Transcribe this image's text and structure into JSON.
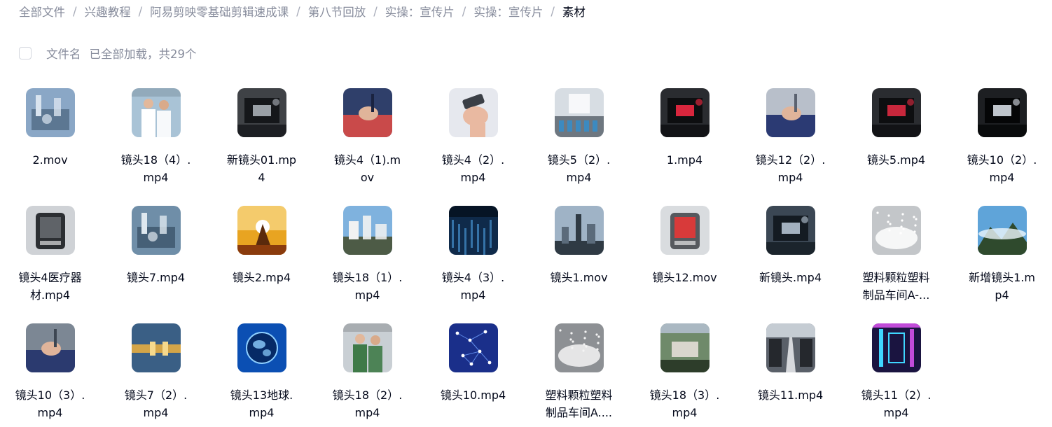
{
  "breadcrumb": [
    "全部文件",
    "兴趣教程",
    "阿易剪映零基础剪辑速成课",
    "第八节回放",
    "实操：宣传片",
    "实操：宣传片",
    "素材"
  ],
  "breadcrumb_separator": "/",
  "toolbar": {
    "sort_label": "文件名",
    "status": "已全部加载，共29个"
  },
  "files": [
    {
      "line1": "2.mov",
      "line2": "",
      "thumb": {
        "bg": "#8aa7c6",
        "accent": "#d9e4ef",
        "dark": "#3e5670",
        "kind": "lab"
      }
    },
    {
      "line1": "镜头18（4）.",
      "line2": "mp4",
      "thumb": {
        "bg": "#a9c3d6",
        "accent": "#ffffff",
        "dark": "#5d6f7f",
        "kind": "people"
      }
    },
    {
      "line1": "新镜头01.mp",
      "line2": "4",
      "thumb": {
        "bg": "#3f4246",
        "accent": "#9aa0a6",
        "dark": "#15171a",
        "kind": "machine"
      }
    },
    {
      "line1": "镜头4（1).m",
      "line2": "ov",
      "thumb": {
        "bg": "#2f3f6a",
        "accent": "#c94a4a",
        "dark": "#1a2340",
        "kind": "hand"
      }
    },
    {
      "line1": "镜头4（2）.",
      "line2": "mp4",
      "thumb": {
        "bg": "#e6e8ee",
        "accent": "#e9b9a1",
        "dark": "#3b3f46",
        "kind": "phone"
      }
    },
    {
      "line1": "镜头5（2）.",
      "line2": "mp4",
      "thumb": {
        "bg": "#d7dde3",
        "accent": "#2f8fd0",
        "dark": "#6e7780",
        "kind": "factory"
      }
    },
    {
      "line1": "1.mp4",
      "line2": "",
      "thumb": {
        "bg": "#2a2c30",
        "accent": "#d9263d",
        "dark": "#0d0e10",
        "kind": "machine"
      }
    },
    {
      "line1": "镜头12（2）.",
      "line2": "mp4",
      "thumb": {
        "bg": "#b8bfca",
        "accent": "#2b3a73",
        "dark": "#5b6270",
        "kind": "hand"
      }
    },
    {
      "line1": "镜头5.mp4",
      "line2": "",
      "thumb": {
        "bg": "#2a2c30",
        "accent": "#c8273c",
        "dark": "#0d0e10",
        "kind": "machine"
      }
    },
    {
      "line1": "镜头10（2）.",
      "line2": "mp4",
      "thumb": {
        "bg": "#1d1f22",
        "accent": "#bfc5cc",
        "dark": "#050607",
        "kind": "machine"
      }
    },
    {
      "line1": "镜头4医疗器",
      "line2": "材.mp4",
      "thumb": {
        "bg": "#cfd2d6",
        "accent": "#5f6368",
        "dark": "#2c2f33",
        "kind": "device"
      }
    },
    {
      "line1": "镜头7.mp4",
      "line2": "",
      "thumb": {
        "bg": "#6f8ea8",
        "accent": "#dfe8ef",
        "dark": "#2b4156",
        "kind": "lab"
      }
    },
    {
      "line1": "镜头2.mp4",
      "line2": "",
      "thumb": {
        "bg": "#e8a421",
        "accent": "#fff1b8",
        "dark": "#5a2a0c",
        "kind": "sunset"
      }
    },
    {
      "line1": "镜头18（1）.",
      "line2": "mp4",
      "thumb": {
        "bg": "#7fb2de",
        "accent": "#f2f2f2",
        "dark": "#4d5b46",
        "kind": "city"
      }
    },
    {
      "line1": "镜头4（3）.",
      "line2": "mp4",
      "thumb": {
        "bg": "#0f2a4a",
        "accent": "#4fa3e6",
        "dark": "#061425",
        "kind": "circuit"
      }
    },
    {
      "line1": "镜头1.mov",
      "line2": "",
      "thumb": {
        "bg": "#9fb3c6",
        "accent": "#5b6b7b",
        "dark": "#2f3a44",
        "kind": "skyline"
      }
    },
    {
      "line1": "镜头12.mov",
      "line2": "",
      "thumb": {
        "bg": "#d9dcdf",
        "accent": "#d83a3a",
        "dark": "#56595e",
        "kind": "device"
      }
    },
    {
      "line1": "新镜头.mp4",
      "line2": "",
      "thumb": {
        "bg": "#3b4754",
        "accent": "#a3b1bf",
        "dark": "#141b22",
        "kind": "machine"
      }
    },
    {
      "line1": "塑料颗粒塑料",
      "line2": "制品车间A-...",
      "thumb": {
        "bg": "#c3c6c9",
        "accent": "#ffffff",
        "dark": "#7b8085",
        "kind": "pellets"
      }
    },
    {
      "line1": "新增镜头1.m",
      "line2": "p4",
      "thumb": {
        "bg": "#5fa4d9",
        "accent": "#eef6fb",
        "dark": "#2f4a2d",
        "kind": "mountain"
      }
    },
    {
      "line1": "镜头10（3）.",
      "line2": "mp4",
      "thumb": {
        "bg": "#7c8794",
        "accent": "#2b3a6f",
        "dark": "#3d4652",
        "kind": "hand"
      }
    },
    {
      "line1": "镜头7（2）.",
      "line2": "mp4",
      "thumb": {
        "bg": "#3a5f85",
        "accent": "#d4a548",
        "dark": "#16283c",
        "kind": "pipe"
      }
    },
    {
      "line1": "镜头13地球.",
      "line2": "mp4",
      "thumb": {
        "bg": "#0b4fb3",
        "accent": "#8fd0ff",
        "dark": "#062a66",
        "kind": "globe"
      }
    },
    {
      "line1": "镜头18（2）.",
      "line2": "mp4",
      "thumb": {
        "bg": "#c9cfd4",
        "accent": "#3f7a48",
        "dark": "#5c5f60",
        "kind": "people"
      }
    },
    {
      "line1": "镜头10.mp4",
      "line2": "",
      "thumb": {
        "bg": "#1a2f8a",
        "accent": "#6fa0ff",
        "dark": "#0a1548",
        "kind": "network"
      }
    },
    {
      "line1": "塑料颗粒塑料",
      "line2": "制品车间A....",
      "thumb": {
        "bg": "#8d9094",
        "accent": "#f4f4f4",
        "dark": "#4c4f53",
        "kind": "pellets"
      }
    },
    {
      "line1": "镜头18（3）.",
      "line2": "mp4",
      "thumb": {
        "bg": "#6f8a6a",
        "accent": "#d9d6cd",
        "dark": "#2d3d2a",
        "kind": "aerial"
      }
    },
    {
      "line1": "镜头11.mp4",
      "line2": "",
      "thumb": {
        "bg": "#5a6069",
        "accent": "#d6d8dc",
        "dark": "#25282d",
        "kind": "road"
      }
    },
    {
      "line1": "镜头11（2）.",
      "line2": "mp4",
      "thumb": {
        "bg": "#1a1440",
        "accent": "#3fd6ff",
        "dark": "#c14bd9",
        "kind": "neon"
      }
    }
  ]
}
